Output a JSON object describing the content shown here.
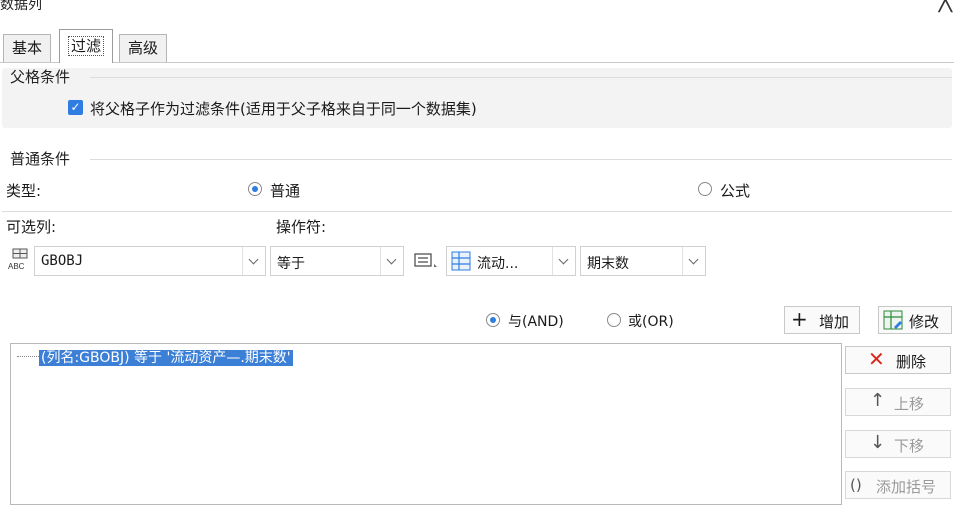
{
  "dialog": {
    "title": "数据列",
    "close_glyph": "╳"
  },
  "tabs": [
    {
      "label": "基本"
    },
    {
      "label": "过滤"
    },
    {
      "label": "高级"
    }
  ],
  "parent_condition": {
    "legend": "父格条件",
    "checkbox_label": "将父格子作为过滤条件(适用于父子格来自于同一个数据集)",
    "checked": true
  },
  "normal_condition": {
    "legend": "普通条件",
    "type_label": "类型:",
    "type_normal": "普通",
    "type_formula": "公式",
    "column_label": "可选列:",
    "operator_label": "操作符:",
    "column_value": "GBOBJ",
    "column_icon_text": "ABC",
    "operator_value": "等于",
    "dataset_value": "流动...",
    "field_value": "期末数"
  },
  "logic": {
    "and_label": "与(AND)",
    "or_label": "或(OR)",
    "add_label": "增加",
    "modify_label": "修改"
  },
  "conditions": [
    "(列名:GBOBJ) 等于 '流动资产—.期末数'"
  ],
  "side_buttons": {
    "delete": "删除",
    "up": "上移",
    "down": "下移",
    "bracket": "添加括号"
  },
  "colors": {
    "accent": "#2f7de1",
    "selection": "#3c7fd6",
    "delete_red": "#d9261c"
  }
}
